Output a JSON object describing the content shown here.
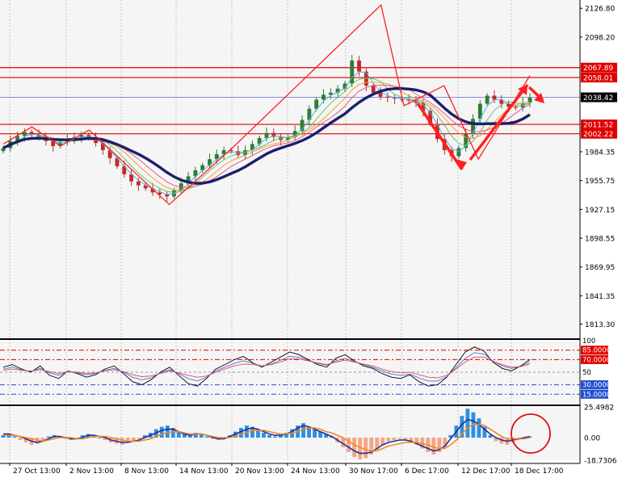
{
  "colors": {
    "background": "#ffffff",
    "plot_bg": "#f5f5f5",
    "grid": "#c8c8c8",
    "axis_text": "#000000",
    "bull": "#2e7d32",
    "bear": "#c62828",
    "wave": "#ff2020",
    "level": "#e00000",
    "current_price": "#5b6bd8",
    "slow_ma": "#1b1f6b",
    "rsi_black": "#000000",
    "rsi_blue": "#4f6be0",
    "rsi_red": "#e05050",
    "macd_pos": "#2f8fe0",
    "macd_neg": "#f4a582",
    "macd_line": "#1f2fa0",
    "signal_line": "#f08a24",
    "highlight": "#e01010"
  },
  "chart_data": [
    {
      "type": "candlestick",
      "title": "",
      "ylim": [
        1800,
        2135
      ],
      "y_ticks": [
        "2126.80",
        "2098.20",
        "1984.35",
        "1955.75",
        "1927.15",
        "1898.55",
        "1869.95",
        "1841.35",
        "1813.30"
      ],
      "x_ticks": [
        "27 Oct 13:00",
        "2 Nov 13:00",
        "8 Nov 13:00",
        "14 Nov 13:00",
        "20 Nov 13:00",
        "24 Nov 13:00",
        "30 Nov 17:00",
        "6 Dec 17:00",
        "12 Dec 17:00",
        "18 Dec 17:00"
      ],
      "price_levels": [
        {
          "label": "2067.89",
          "value": 2067.89
        },
        {
          "label": "2058.01",
          "value": 2058.01
        },
        {
          "label": "2011.52",
          "value": 2011.52
        },
        {
          "label": "2002.22",
          "value": 2002.22
        }
      ],
      "current_price": {
        "label": "2038.42",
        "value": 2038.42
      },
      "close": [
        1988,
        1995,
        2000,
        2004,
        2001,
        1999,
        1995,
        1990,
        1994,
        1997,
        1999,
        2001,
        1998,
        1993,
        1986,
        1978,
        1970,
        1962,
        1955,
        1951,
        1948,
        1944,
        1942,
        1940,
        1946,
        1953,
        1960,
        1966,
        1971,
        1977,
        1982,
        1986,
        1985,
        1981,
        1986,
        1992,
        1998,
        2003,
        1999,
        1996,
        1999,
        2005,
        2016,
        2027,
        2036,
        2041,
        2043,
        2047,
        2052,
        2075,
        2064,
        2050,
        2043,
        2039,
        2038,
        2037,
        2036,
        2035,
        2033,
        2025,
        2012,
        1997,
        1986,
        1980,
        1988,
        2002,
        2017,
        2032,
        2040,
        2036,
        2032,
        2029,
        2028,
        2033,
        2038
      ],
      "moving_averages": [
        {
          "name": "",
          "color": "#1b1f6b",
          "width": 3.4,
          "period": 12
        },
        {
          "name": "",
          "color": "#e05a8a",
          "width": 1,
          "period": 9
        },
        {
          "name": "",
          "color": "#f0a030",
          "width": 1,
          "period": 7
        },
        {
          "name": "",
          "color": "#6cc070",
          "width": 1,
          "period": 5
        },
        {
          "name": "",
          "color": "#50b0e0",
          "width": 1,
          "period": 3
        }
      ],
      "wave_lines": {
        "color": "#ff2020",
        "points": [
          {
            "i": 0,
            "price": 1992
          },
          {
            "i": 5,
            "price": 2009
          },
          {
            "i": 10,
            "price": 1990
          },
          {
            "i": 15,
            "price": 2006
          },
          {
            "i": 29,
            "price": 1932
          },
          {
            "i": 40,
            "price": 1988
          },
          {
            "i": 66,
            "price": 2130
          },
          {
            "i": 70,
            "price": 2030
          },
          {
            "i": 77,
            "price": 2050
          },
          {
            "i": 83,
            "price": 1977
          },
          {
            "i": 92,
            "price": 2060
          }
        ]
      }
    },
    {
      "type": "line",
      "title": "",
      "ylim": [
        0,
        100
      ],
      "y_ticks": [
        "100",
        "85.0000",
        "70.0000",
        "50",
        "30.0000",
        "15.0000"
      ],
      "levels": [
        85,
        70,
        50,
        30,
        15
      ],
      "series": [
        {
          "name": "",
          "color": "#000000",
          "values": [
            58,
            62,
            55,
            50,
            60,
            45,
            40,
            52,
            48,
            42,
            46,
            55,
            60,
            48,
            35,
            30,
            38,
            50,
            58,
            45,
            32,
            28,
            40,
            55,
            62,
            70,
            75,
            65,
            58,
            66,
            74,
            82,
            78,
            70,
            62,
            58,
            72,
            78,
            68,
            60,
            56,
            48,
            42,
            40,
            46,
            35,
            28,
            30,
            42,
            62,
            82,
            90,
            84,
            66,
            56,
            52,
            60,
            70
          ]
        },
        {
          "name": "",
          "color": "#4f6be0",
          "values": [
            55,
            58,
            54,
            51,
            56,
            49,
            45,
            51,
            49,
            46,
            48,
            53,
            56,
            50,
            42,
            38,
            41,
            49,
            54,
            48,
            40,
            36,
            42,
            52,
            58,
            64,
            68,
            64,
            60,
            63,
            69,
            75,
            74,
            69,
            64,
            61,
            68,
            72,
            67,
            62,
            58,
            52,
            47,
            45,
            47,
            41,
            36,
            36,
            43,
            57,
            72,
            81,
            79,
            68,
            60,
            56,
            59,
            66
          ]
        },
        {
          "name": "",
          "color": "#e05050",
          "values": [
            53,
            55,
            53,
            52,
            54,
            51,
            48,
            51,
            50,
            48,
            49,
            52,
            54,
            51,
            46,
            43,
            44,
            48,
            52,
            49,
            45,
            42,
            44,
            50,
            55,
            60,
            63,
            62,
            60,
            62,
            66,
            71,
            71,
            68,
            65,
            62,
            66,
            69,
            66,
            63,
            60,
            55,
            51,
            49,
            50,
            46,
            42,
            41,
            45,
            55,
            66,
            74,
            74,
            67,
            62,
            58,
            59,
            63
          ]
        }
      ]
    },
    {
      "type": "bar",
      "title": "",
      "ylim": [
        -18.7306,
        25.4982
      ],
      "y_ticks": [
        "25.4982",
        "0.00",
        "-18.7306"
      ],
      "histogram": [
        2,
        3,
        1,
        -2,
        -4,
        -6,
        -5,
        -3,
        1,
        2,
        1,
        -1,
        -2,
        -1,
        2,
        3,
        1,
        0,
        -2,
        -4,
        -5,
        -6,
        -4,
        -3,
        -1,
        2,
        4,
        7,
        9,
        10,
        8,
        5,
        3,
        2,
        4,
        3,
        1,
        -1,
        -2,
        -1,
        2,
        5,
        8,
        10,
        9,
        7,
        4,
        2,
        1,
        2,
        4,
        7,
        10,
        12,
        9,
        7,
        5,
        3,
        1,
        -4,
        -8,
        -12,
        -16,
        -18,
        -17,
        -14,
        -10,
        -6,
        -3,
        -2,
        -1,
        -2,
        -4,
        -6,
        -9,
        -12,
        -14,
        -12,
        -8,
        2,
        10,
        18,
        24,
        21,
        16,
        9,
        2,
        -3,
        -5,
        -6,
        -4,
        -2,
        0,
        1
      ],
      "series": [
        {
          "name": "",
          "color": "#1f2fa0",
          "values": [
            3,
            3,
            2,
            1,
            -1,
            -3,
            -4,
            -3,
            -1,
            1,
            1,
            0,
            -1,
            -1,
            0,
            2,
            2,
            1,
            0,
            -2,
            -3,
            -4,
            -4,
            -3,
            -2,
            0,
            2,
            4,
            6,
            7,
            7,
            5,
            3,
            2,
            3,
            3,
            2,
            0,
            -1,
            -1,
            1,
            3,
            5,
            7,
            8,
            7,
            5,
            3,
            2,
            2,
            3,
            5,
            8,
            10,
            9,
            7,
            5,
            3,
            1,
            -2,
            -5,
            -8,
            -11,
            -13,
            -13,
            -12,
            -9,
            -6,
            -4,
            -3,
            -2,
            -2,
            -3,
            -5,
            -7,
            -9,
            -11,
            -10,
            -7,
            -1,
            5,
            11,
            15,
            14,
            11,
            7,
            3,
            0,
            -2,
            -3,
            -2,
            -1,
            0,
            1
          ]
        },
        {
          "name": "",
          "color": "#f08a24",
          "values": [
            2,
            2,
            2,
            1,
            0,
            -1,
            -2,
            -3,
            -2,
            -1,
            0,
            0,
            0,
            -1,
            -1,
            0,
            1,
            1,
            1,
            0,
            -1,
            -2,
            -3,
            -3,
            -3,
            -2,
            -1,
            1,
            3,
            4,
            5,
            5,
            4,
            3,
            3,
            3,
            2,
            1,
            0,
            0,
            0,
            1,
            3,
            4,
            6,
            6,
            6,
            5,
            4,
            3,
            3,
            4,
            5,
            7,
            8,
            8,
            7,
            5,
            4,
            2,
            0,
            -3,
            -6,
            -8,
            -10,
            -11,
            -11,
            -9,
            -7,
            -6,
            -5,
            -4,
            -4,
            -4,
            -5,
            -6,
            -8,
            -9,
            -9,
            -6,
            -2,
            3,
            8,
            11,
            11,
            10,
            7,
            4,
            1,
            -1,
            -1,
            -1,
            -1,
            0
          ]
        }
      ]
    }
  ]
}
